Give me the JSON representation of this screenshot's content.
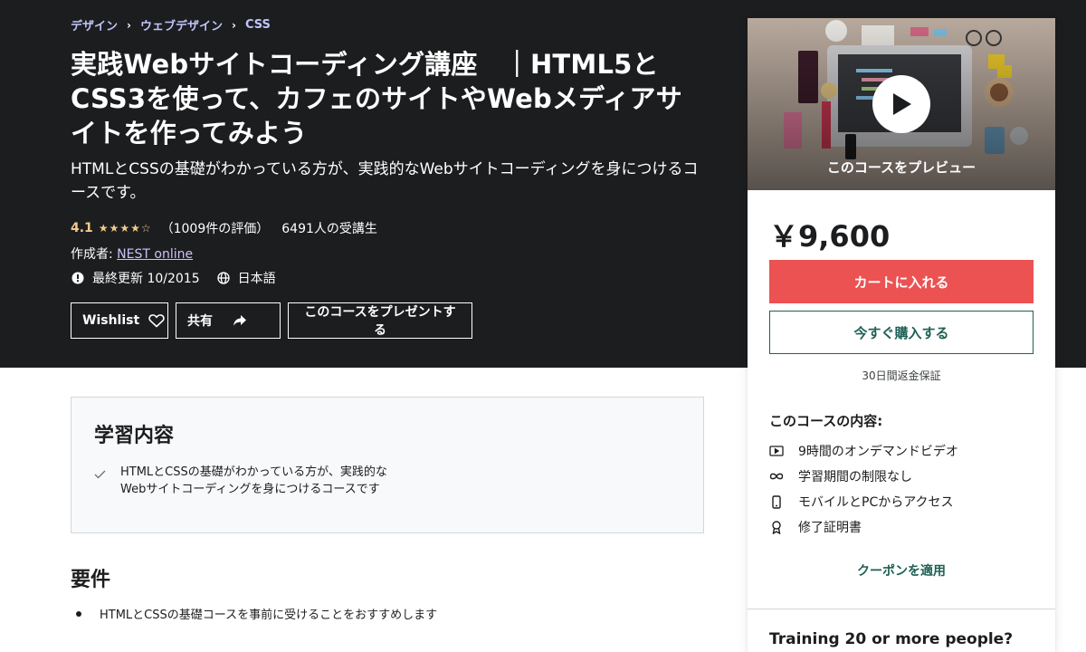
{
  "breadcrumb": [
    "デザイン",
    "ウェブデザイン",
    "CSS"
  ],
  "course": {
    "title": "実践Webサイトコーディング講座　｜HTML5とCSS3を使って、カフェのサイトやWebメディアサイトを作ってみよう",
    "subtitle": "HTMLとCSSの基礎がわかっている方が、実践的なWebサイトコーディングを身につけるコースです。",
    "rating": "4.1",
    "stars": "★★★★☆",
    "reviews": "（1009件の評価）",
    "students": "6491人の受講生",
    "author_prefix": "作成者: ",
    "author": "NEST online",
    "updated": "最終更新 10/2015",
    "language": "日本語"
  },
  "actions": {
    "wishlist": "Wishlist",
    "share": "共有",
    "gift": "このコースをプレゼントする"
  },
  "sidebar": {
    "preview_label": "このコースをプレビュー",
    "price": "￥9,600",
    "cart": "カートに入れる",
    "buy": "今すぐ購入する",
    "guarantee": "30日間返金保証",
    "includes_title": "このコースの内容:",
    "includes": [
      {
        "icon": "video-icon",
        "label": "9時間のオンデマンドビデオ"
      },
      {
        "icon": "infinity-icon",
        "label": "学習期間の制限なし"
      },
      {
        "icon": "mobile-icon",
        "label": "モバイルとPCからアクセス"
      },
      {
        "icon": "certificate-icon",
        "label": "修了証明書"
      }
    ],
    "coupon": "クーポンを適用",
    "training": "Training 20 or more people?"
  },
  "learn": {
    "title": "学習内容",
    "items": [
      "HTMLとCSSの基礎がわかっている方が、実践的なWebサイトコーディングを身につけるコースです"
    ]
  },
  "requirements": {
    "title": "要件",
    "items": [
      "HTMLとCSSの基礎コースを事前に受けることをおすすめします"
    ]
  },
  "colors": {
    "hero_bg": "#1c1d1f",
    "accent_purple": "#cec0fc",
    "star": "#f3ca8c",
    "cart": "#ec5252",
    "teal": "#1e6055"
  }
}
